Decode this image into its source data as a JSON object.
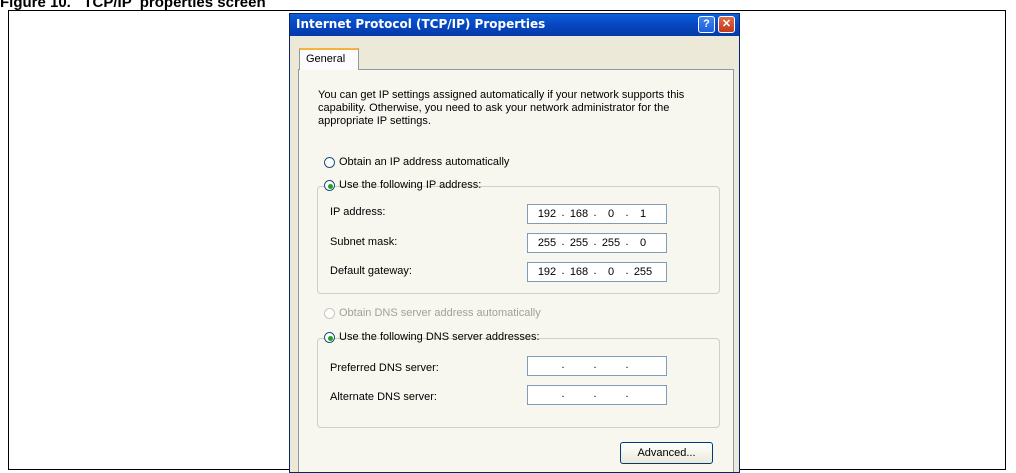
{
  "figure_caption": "Figure 10.   TCP/IP  properties screen",
  "dialog": {
    "title": "Internet Protocol (TCP/IP) Properties",
    "help_label": "?",
    "close_label": "✕",
    "tab_general": "General",
    "intro_text": "You can get IP settings assigned automatically if your network supports this capability. Otherwise, you need to ask your network administrator for the appropriate IP settings.",
    "ip": {
      "auto_label": "Obtain an IP address automatically",
      "manual_label": "Use the following IP address:",
      "selected": "manual",
      "fields": [
        {
          "label": "IP address:",
          "octets": [
            "192",
            "168",
            "0",
            "1"
          ]
        },
        {
          "label": "Subnet mask:",
          "octets": [
            "255",
            "255",
            "255",
            "0"
          ]
        },
        {
          "label": "Default gateway:",
          "octets": [
            "192",
            "168",
            "0",
            "255"
          ]
        }
      ]
    },
    "dns": {
      "auto_label": "Obtain DNS server address automatically",
      "auto_disabled": true,
      "manual_label": "Use the following DNS server addresses:",
      "selected": "manual",
      "fields": [
        {
          "label": "Preferred DNS server:",
          "octets": [
            "",
            "",
            "",
            ""
          ]
        },
        {
          "label": "Alternate DNS server:",
          "octets": [
            "",
            "",
            "",
            ""
          ]
        }
      ]
    },
    "advanced_label": "Advanced..."
  },
  "colors": {
    "titlebar": "#0748c4",
    "dialog_bg": "#ece9d8",
    "radio_selected": "#21a121",
    "tab_highlight": "#f3b33d"
  }
}
